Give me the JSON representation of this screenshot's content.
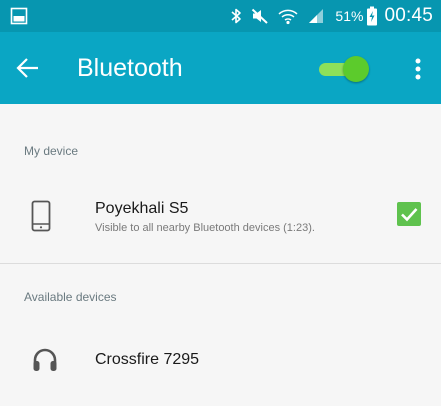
{
  "status_bar": {
    "battery_percent": "51%",
    "time": "00:45",
    "icons": [
      "gallery-icon",
      "bluetooth-icon",
      "mute-icon",
      "wifi-icon",
      "signal-icon",
      "battery-charging-icon"
    ]
  },
  "app_bar": {
    "title": "Bluetooth",
    "bluetooth_enabled": true,
    "icons": [
      "back-arrow-icon",
      "overflow-menu-icon"
    ]
  },
  "my_device": {
    "section_label": "My device",
    "name": "Poyekhali S5",
    "status": "Visible to all nearby Bluetooth devices (1:23).",
    "icon": "phone-icon",
    "visible_checked": true
  },
  "available_devices": {
    "section_label": "Available devices",
    "items": [
      {
        "name": "Crossfire 7295",
        "icon": "headphones-icon"
      }
    ]
  },
  "colors": {
    "status_bar": "#0796b0",
    "app_bar": "#0aa6c4",
    "toggle_on": "#5ccb2c",
    "checkbox": "#5fc24e",
    "background": "#f6f6f6"
  }
}
